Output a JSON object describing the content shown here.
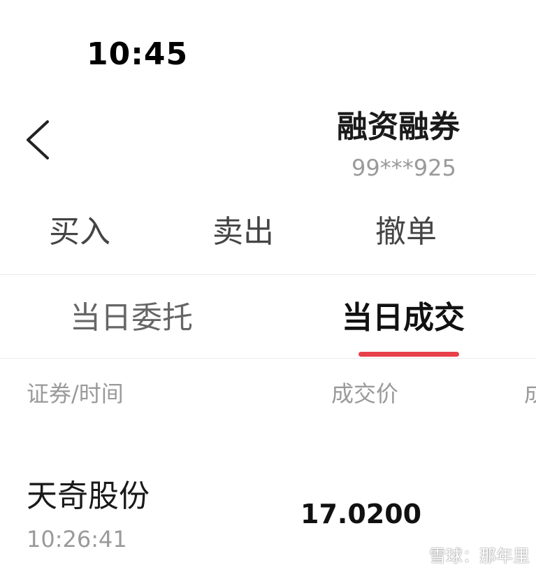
{
  "status_bar": {
    "time": "10:45"
  },
  "header": {
    "title": "融资融券",
    "account": "99***925",
    "back_icon": "chevron-left-icon"
  },
  "action_tabs": [
    {
      "label": "买入"
    },
    {
      "label": "卖出"
    },
    {
      "label": "撤单"
    }
  ],
  "sub_tabs": {
    "items": [
      {
        "label": "当日委托",
        "active": false
      },
      {
        "label": "当日成交",
        "active": true
      }
    ],
    "indicator_color": "#e8404a"
  },
  "table": {
    "columns": [
      "证券/时间",
      "成交价",
      "成"
    ],
    "rows": [
      {
        "name": "天奇股份",
        "time": "10:26:41",
        "price": "17.0200"
      }
    ]
  },
  "watermark": {
    "text": "雪球：那年里",
    "icon": "snowball-logo-icon"
  }
}
